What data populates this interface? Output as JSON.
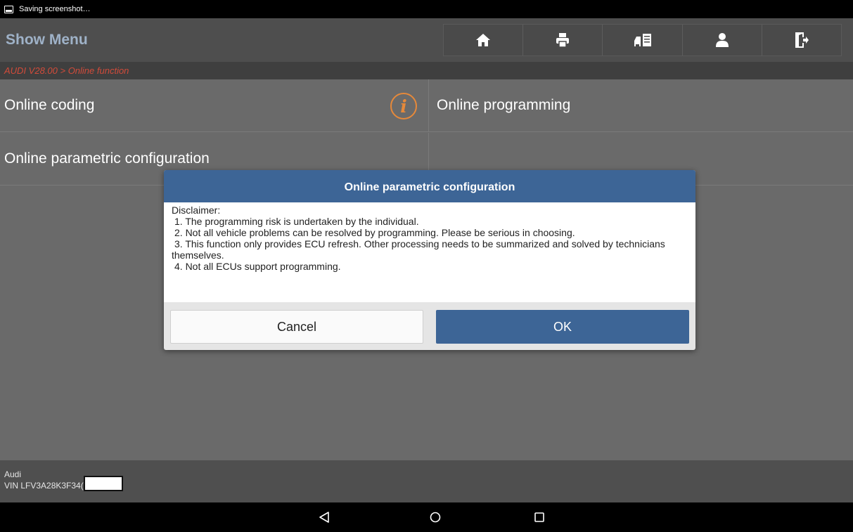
{
  "status_bar": {
    "notification": "Saving screenshot…"
  },
  "header": {
    "title": "Show Menu",
    "toolbar": [
      {
        "icon": "home-icon"
      },
      {
        "icon": "print-icon"
      },
      {
        "icon": "car-report-icon"
      },
      {
        "icon": "user-icon"
      },
      {
        "icon": "exit-icon"
      }
    ]
  },
  "breadcrumb": "AUDI V28.00 > Online function",
  "menu": {
    "items": [
      {
        "label": "Online coding"
      },
      {
        "label": "Online programming"
      },
      {
        "label": "Online parametric configuration"
      }
    ]
  },
  "dialog": {
    "title": "Online parametric configuration",
    "lines": [
      "Disclaimer:",
      " 1. The programming risk is undertaken by the individual.",
      " 2. Not all vehicle problems can be resolved by programming. Please be serious in choosing.",
      " 3. This function only provides ECU refresh. Other processing needs to be summarized and solved by technicians themselves.",
      " 4. Not all ECUs support programming."
    ],
    "cancel_label": "Cancel",
    "ok_label": "OK"
  },
  "footer": {
    "make": "Audi",
    "vin": "VIN LFV3A28K3F34("
  },
  "colors": {
    "accent": "#3d6596",
    "breadcrumb": "#d24b3a",
    "info_icon": "#e6893a",
    "header_title": "#9fb2c8"
  }
}
